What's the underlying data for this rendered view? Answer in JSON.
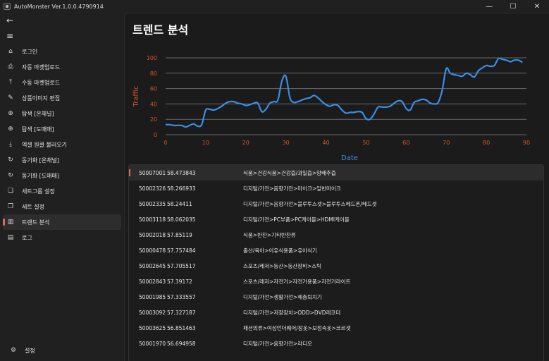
{
  "window": {
    "title": "AutoMonster Ver.1.0.0.4790914",
    "minimize_glyph": "—",
    "maximize_glyph": "☐",
    "close_glyph": "✕"
  },
  "sidebar": {
    "back_glyph": "←",
    "menu_glyph": "≡",
    "items": [
      {
        "label": "로그인",
        "icon": "login-icon",
        "glyph": "⌂"
      },
      {
        "label": "자동 마켓업로드",
        "icon": "auto-upload-icon",
        "glyph": "⎙"
      },
      {
        "label": "수동 마켓업로드",
        "icon": "manual-upload-icon",
        "glyph": "⤒"
      },
      {
        "label": "상품이미지 편집",
        "icon": "edit-icon",
        "glyph": "✎"
      },
      {
        "label": "탐색 [온채널]",
        "icon": "globe-icon",
        "glyph": "⊕"
      },
      {
        "label": "탐색 [도매매]",
        "icon": "globe-icon",
        "glyph": "⊕"
      },
      {
        "label": "엑셀 원클 불러오기",
        "icon": "download-icon",
        "glyph": "⤓"
      },
      {
        "label": "동기화 [온채널]",
        "icon": "sync-icon",
        "glyph": "↻"
      },
      {
        "label": "동기화 [도매매]",
        "icon": "sync-icon",
        "glyph": "↻"
      },
      {
        "label": "세트그룹 설정",
        "icon": "set-group-icon",
        "glyph": "❏"
      },
      {
        "label": "세트 설정",
        "icon": "set-icon",
        "glyph": "❐"
      },
      {
        "label": "트렌드 분석",
        "icon": "trend-icon",
        "glyph": "▥"
      },
      {
        "label": "로그",
        "icon": "log-icon",
        "glyph": "▤"
      }
    ],
    "active_index": 11,
    "settings": {
      "label": "설정",
      "icon": "gear-icon",
      "glyph": "⚙"
    }
  },
  "main": {
    "title": "트렌드 분석"
  },
  "chart_data": {
    "type": "line",
    "xlabel": "Date",
    "ylabel": "Traffic",
    "xlim": [
      0,
      90
    ],
    "ylim": [
      0,
      100
    ],
    "x_ticks": [
      0,
      10,
      20,
      30,
      40,
      50,
      60,
      70,
      80,
      90
    ],
    "y_ticks": [
      0,
      20,
      40,
      60,
      80,
      100
    ],
    "grid": "horizontal",
    "line_color": "#3a8ee6",
    "axis_label_color": "#d4552b",
    "tick_color": "#d4552b",
    "series": [
      {
        "x": [
          0,
          1,
          2,
          3,
          4,
          5,
          6,
          7,
          8,
          9,
          10,
          11,
          12,
          13,
          14,
          15,
          16,
          17,
          18,
          19,
          20,
          21,
          22,
          23,
          24,
          25,
          26,
          27,
          28,
          29,
          30,
          31,
          32,
          33,
          34,
          35,
          36,
          37,
          38,
          39,
          40,
          41,
          42,
          43,
          44,
          45,
          46,
          47,
          48,
          49,
          50,
          51,
          52,
          53,
          54,
          55,
          56,
          57,
          58,
          59,
          60,
          61,
          62,
          63,
          64,
          65,
          66,
          67,
          68,
          69,
          70,
          71,
          72,
          73,
          74,
          75,
          76,
          77,
          78,
          79,
          80,
          81,
          82,
          83,
          84,
          85,
          86,
          87,
          88,
          89
        ],
        "y": [
          13,
          13,
          12,
          12,
          12,
          10,
          12,
          14,
          11,
          13,
          32,
          33,
          32,
          34,
          37,
          41,
          43,
          43,
          41,
          40,
          38,
          39,
          41,
          41,
          30,
          33,
          41,
          43,
          45,
          70,
          76,
          48,
          42,
          43,
          45,
          47,
          48,
          51,
          48,
          43,
          39,
          37,
          39,
          38,
          32,
          28,
          29,
          29,
          30,
          29,
          21,
          20,
          27,
          36,
          36,
          36,
          37,
          41,
          44,
          43,
          34,
          32,
          42,
          44,
          46,
          45,
          41,
          40,
          42,
          58,
          86,
          80,
          78,
          77,
          76,
          80,
          78,
          75,
          83,
          87,
          90,
          89,
          90,
          99,
          98,
          97,
          95,
          97,
          97,
          94
        ]
      }
    ]
  },
  "table": {
    "rows": [
      {
        "id": "50007001",
        "score": "58.473843",
        "category": "식품>건강식품>건강즙/과일즙>양배추즙"
      },
      {
        "id": "50002326",
        "score": "58.266933",
        "category": "디지털/가전>음향가전>마이크>일반마이크"
      },
      {
        "id": "50002335",
        "score": "58.24411",
        "category": "디지털/가전>음향가전>블루투스셋>블루투스헤드폰/헤드셋"
      },
      {
        "id": "50003118",
        "score": "58.062035",
        "category": "디지털/가전>PC부품>PC케이블>HDMI케이블"
      },
      {
        "id": "50002018",
        "score": "57.85119",
        "category": "식품>반찬>기타반찬류"
      },
      {
        "id": "50000478",
        "score": "57.757484",
        "category": "출산/육아>이유식용품>유아식기"
      },
      {
        "id": "50002645",
        "score": "57.705517",
        "category": "스포츠/레저>등산>등산장비>스틱"
      },
      {
        "id": "50002843",
        "score": "57.39172",
        "category": "스포츠/레저>자전거>자전거용품>자전거라이트"
      },
      {
        "id": "50001985",
        "score": "57.333557",
        "category": "디지털/가전>생활가전>해충퇴치기"
      },
      {
        "id": "50003092",
        "score": "57.327187",
        "category": "디지털/가전>저장장치>ODD>DVD레코더"
      },
      {
        "id": "50003625",
        "score": "56.851463",
        "category": "패션의류>여성언더웨어/잠옷>보정속옷>코르셋"
      },
      {
        "id": "50001970",
        "score": "56.694958",
        "category": "디지털/가전>음향가전>라디오"
      }
    ],
    "selected_index": 0
  }
}
